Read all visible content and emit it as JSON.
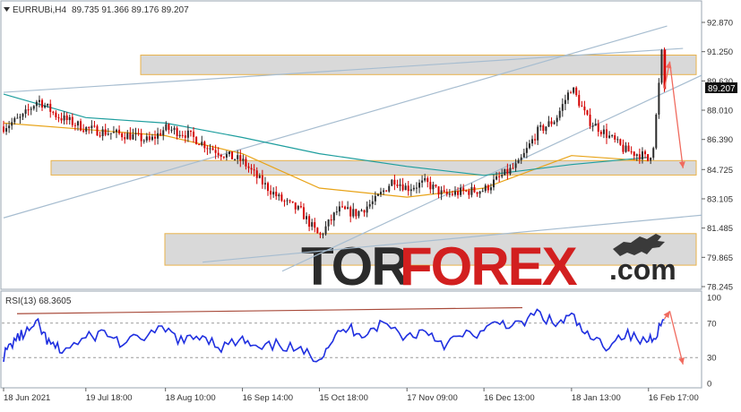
{
  "header": {
    "symbol": "EURRUBi,H4",
    "ohlc": "89.735 91.366 89.176 89.207",
    "menu_icon": "triangle-down-icon"
  },
  "current_price_label": "89.207",
  "watermark": {
    "text_dark": "TOR",
    "text_red": "FOREX",
    "text_suffix": ".com",
    "logo_icon": "bull-icon"
  },
  "rsi": {
    "label": "RSI(13) 68.3605",
    "levels": [
      "100",
      "70",
      "30",
      "0"
    ]
  },
  "x_ticks": [
    "18 Jun 2021",
    "19 Jul 18:00",
    "18 Aug 10:00",
    "16 Sep 14:00",
    "15 Oct 18:00",
    "17 Nov 09:00",
    "16 Dec 13:00",
    "18 Jan 13:00",
    "16 Feb 17:00"
  ],
  "colors": {
    "bull": "#2a2a2a",
    "bear": "#d40000",
    "ma_slow": "#1e9e9e",
    "ma_fast": "#e8a317",
    "channel": "#a7bdd0",
    "zone_fill": "#d9d9d9",
    "zone_stroke": "#e8b24a",
    "forecast": "#f06a5e",
    "rsi_line": "#1f2fe0",
    "rsi_trend": "#a84a3a"
  },
  "chart_data": [
    {
      "type": "candlestick",
      "title": "EURRUBi,H4",
      "y_ticks": [
        "92.870",
        "91.250",
        "89.630",
        "88.010",
        "86.390",
        "84.725",
        "83.105",
        "81.485",
        "79.865",
        "78.245"
      ],
      "ylim": [
        78.245,
        92.87
      ],
      "x_range": [
        "2021-06-18",
        "2022-03-08"
      ],
      "last_price": 89.207,
      "close_path": [
        [
          "2021-06-18",
          87.1
        ],
        [
          "2021-06-25",
          87.6
        ],
        [
          "2021-07-01",
          88.6
        ],
        [
          "2021-07-08",
          87.7
        ],
        [
          "2021-07-19",
          87.0
        ],
        [
          "2021-07-26",
          86.8
        ],
        [
          "2021-08-05",
          86.6
        ],
        [
          "2021-08-12",
          86.3
        ],
        [
          "2021-08-18",
          87.0
        ],
        [
          "2021-08-26",
          86.7
        ],
        [
          "2021-09-03",
          86.0
        ],
        [
          "2021-09-10",
          85.5
        ],
        [
          "2021-09-16",
          85.2
        ],
        [
          "2021-09-22",
          84.2
        ],
        [
          "2021-09-30",
          83.1
        ],
        [
          "2021-10-08",
          82.4
        ],
        [
          "2021-10-15",
          81.0
        ],
        [
          "2021-10-22",
          82.5
        ],
        [
          "2021-10-29",
          82.3
        ],
        [
          "2021-11-05",
          83.0
        ],
        [
          "2021-11-12",
          84.2
        ],
        [
          "2021-11-17",
          83.7
        ],
        [
          "2021-11-24",
          84.0
        ],
        [
          "2021-12-01",
          83.3
        ],
        [
          "2021-12-08",
          83.5
        ],
        [
          "2021-12-16",
          83.6
        ],
        [
          "2021-12-22",
          84.3
        ],
        [
          "2021-12-29",
          85.0
        ],
        [
          "2022-01-05",
          86.8
        ],
        [
          "2022-01-12",
          87.5
        ],
        [
          "2022-01-18",
          89.3
        ],
        [
          "2022-01-24",
          87.5
        ],
        [
          "2022-01-31",
          86.7
        ],
        [
          "2022-02-07",
          85.8
        ],
        [
          "2022-02-14",
          85.5
        ],
        [
          "2022-02-16",
          85.2
        ],
        [
          "2022-02-18",
          86.2
        ],
        [
          "2022-02-21",
          91.2
        ],
        [
          "2022-02-22",
          89.2
        ]
      ],
      "moving_averages": [
        {
          "color": "ma_fast",
          "values": [
            [
              "2021-06-18",
              87.3
            ],
            [
              "2021-08-18",
              86.6
            ],
            [
              "2021-09-16",
              85.6
            ],
            [
              "2021-10-15",
              83.7
            ],
            [
              "2021-11-17",
              83.2
            ],
            [
              "2021-12-16",
              83.7
            ],
            [
              "2022-01-18",
              85.5
            ],
            [
              "2022-02-16",
              85.2
            ]
          ]
        },
        {
          "color": "ma_slow",
          "values": [
            [
              "2021-06-18",
              88.9
            ],
            [
              "2021-07-19",
              87.6
            ],
            [
              "2021-08-18",
              87.3
            ],
            [
              "2021-09-16",
              86.5
            ],
            [
              "2021-10-15",
              85.6
            ],
            [
              "2021-11-17",
              84.9
            ],
            [
              "2021-12-16",
              84.4
            ],
            [
              "2022-01-18",
              85.0
            ],
            [
              "2022-02-16",
              85.4
            ]
          ]
        }
      ],
      "support_resistance_zones": [
        [
          89.98,
          91.06
        ],
        [
          84.42,
          85.22
        ],
        [
          79.43,
          81.18
        ]
      ],
      "channel_lines": [
        {
          "from": [
            "2021-06-18",
            82.05
          ],
          "to": [
            "2022-02-23",
            92.67
          ]
        },
        {
          "from": [
            "2021-10-01",
            79.1
          ],
          "to": [
            "2022-03-08",
            89.94
          ]
        },
        {
          "from": [
            "2021-06-18",
            89.0
          ],
          "to": [
            "2022-03-01",
            91.43
          ]
        },
        {
          "from": [
            "2021-09-01",
            79.6
          ],
          "to": [
            "2022-03-08",
            82.2
          ]
        }
      ],
      "forecast_path": [
        [
          "2022-02-22",
          89.2
        ],
        [
          "2022-02-24",
          90.7
        ],
        [
          "2022-03-01",
          84.8
        ]
      ]
    },
    {
      "type": "line",
      "title": "RSI(13) 68.3605",
      "ylim": [
        0,
        100
      ],
      "levels": [
        70,
        30
      ],
      "last_value": 68.3605,
      "trendline": {
        "from": [
          "2021-06-18",
          81
        ],
        "to": [
          "2022-03-08",
          88
        ]
      },
      "forecast_path": [
        [
          "2022-02-22",
          75
        ],
        [
          "2022-02-24",
          84
        ],
        [
          "2022-03-01",
          22
        ]
      ],
      "values": [
        [
          "2021-06-18",
          32
        ],
        [
          "2021-06-22",
          50
        ],
        [
          "2021-06-26",
          58
        ],
        [
          "2021-07-01",
          68
        ],
        [
          "2021-07-05",
          46
        ],
        [
          "2021-07-10",
          38
        ],
        [
          "2021-07-19",
          52
        ],
        [
          "2021-07-26",
          60
        ],
        [
          "2021-08-02",
          45
        ],
        [
          "2021-08-10",
          55
        ],
        [
          "2021-08-18",
          62
        ],
        [
          "2021-08-25",
          48
        ],
        [
          "2021-09-01",
          57
        ],
        [
          "2021-09-08",
          42
        ],
        [
          "2021-09-16",
          50
        ],
        [
          "2021-09-22",
          38
        ],
        [
          "2021-09-30",
          46
        ],
        [
          "2021-10-08",
          36
        ],
        [
          "2021-10-15",
          30
        ],
        [
          "2021-10-20",
          52
        ],
        [
          "2021-10-26",
          64
        ],
        [
          "2021-11-01",
          58
        ],
        [
          "2021-11-08",
          70
        ],
        [
          "2021-11-17",
          54
        ],
        [
          "2021-11-24",
          62
        ],
        [
          "2021-12-01",
          46
        ],
        [
          "2021-12-08",
          55
        ],
        [
          "2021-12-16",
          60
        ],
        [
          "2021-12-22",
          72
        ],
        [
          "2021-12-29",
          66
        ],
        [
          "2022-01-05",
          82
        ],
        [
          "2022-01-12",
          68
        ],
        [
          "2022-01-18",
          78
        ],
        [
          "2022-01-24",
          54
        ],
        [
          "2022-01-31",
          44
        ],
        [
          "2022-02-07",
          58
        ],
        [
          "2022-02-14",
          48
        ],
        [
          "2022-02-18",
          55
        ],
        [
          "2022-02-22",
          74
        ]
      ]
    }
  ]
}
